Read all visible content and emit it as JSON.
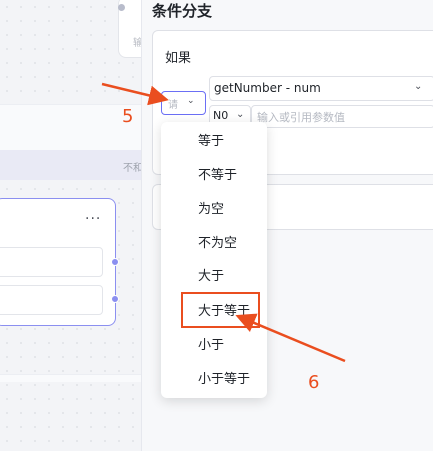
{
  "panel": {
    "title": "条件分支",
    "condition_label": "如果",
    "operator_placeholder": "请",
    "variable_value": "getNumber - num",
    "type_value": "N0",
    "param_placeholder": "输入或引用参数值"
  },
  "canvas": {
    "top_node_text": "输",
    "strip_text": "不和",
    "card_more": "···"
  },
  "operator_menu": {
    "items": [
      "等于",
      "不等于",
      "为空",
      "不为空",
      "大于",
      "大于等于",
      "小于",
      "小于等于"
    ],
    "highlighted": "大于等于"
  },
  "annotations": {
    "step5": "5",
    "step6": "6",
    "color": "#ea4e1f"
  }
}
